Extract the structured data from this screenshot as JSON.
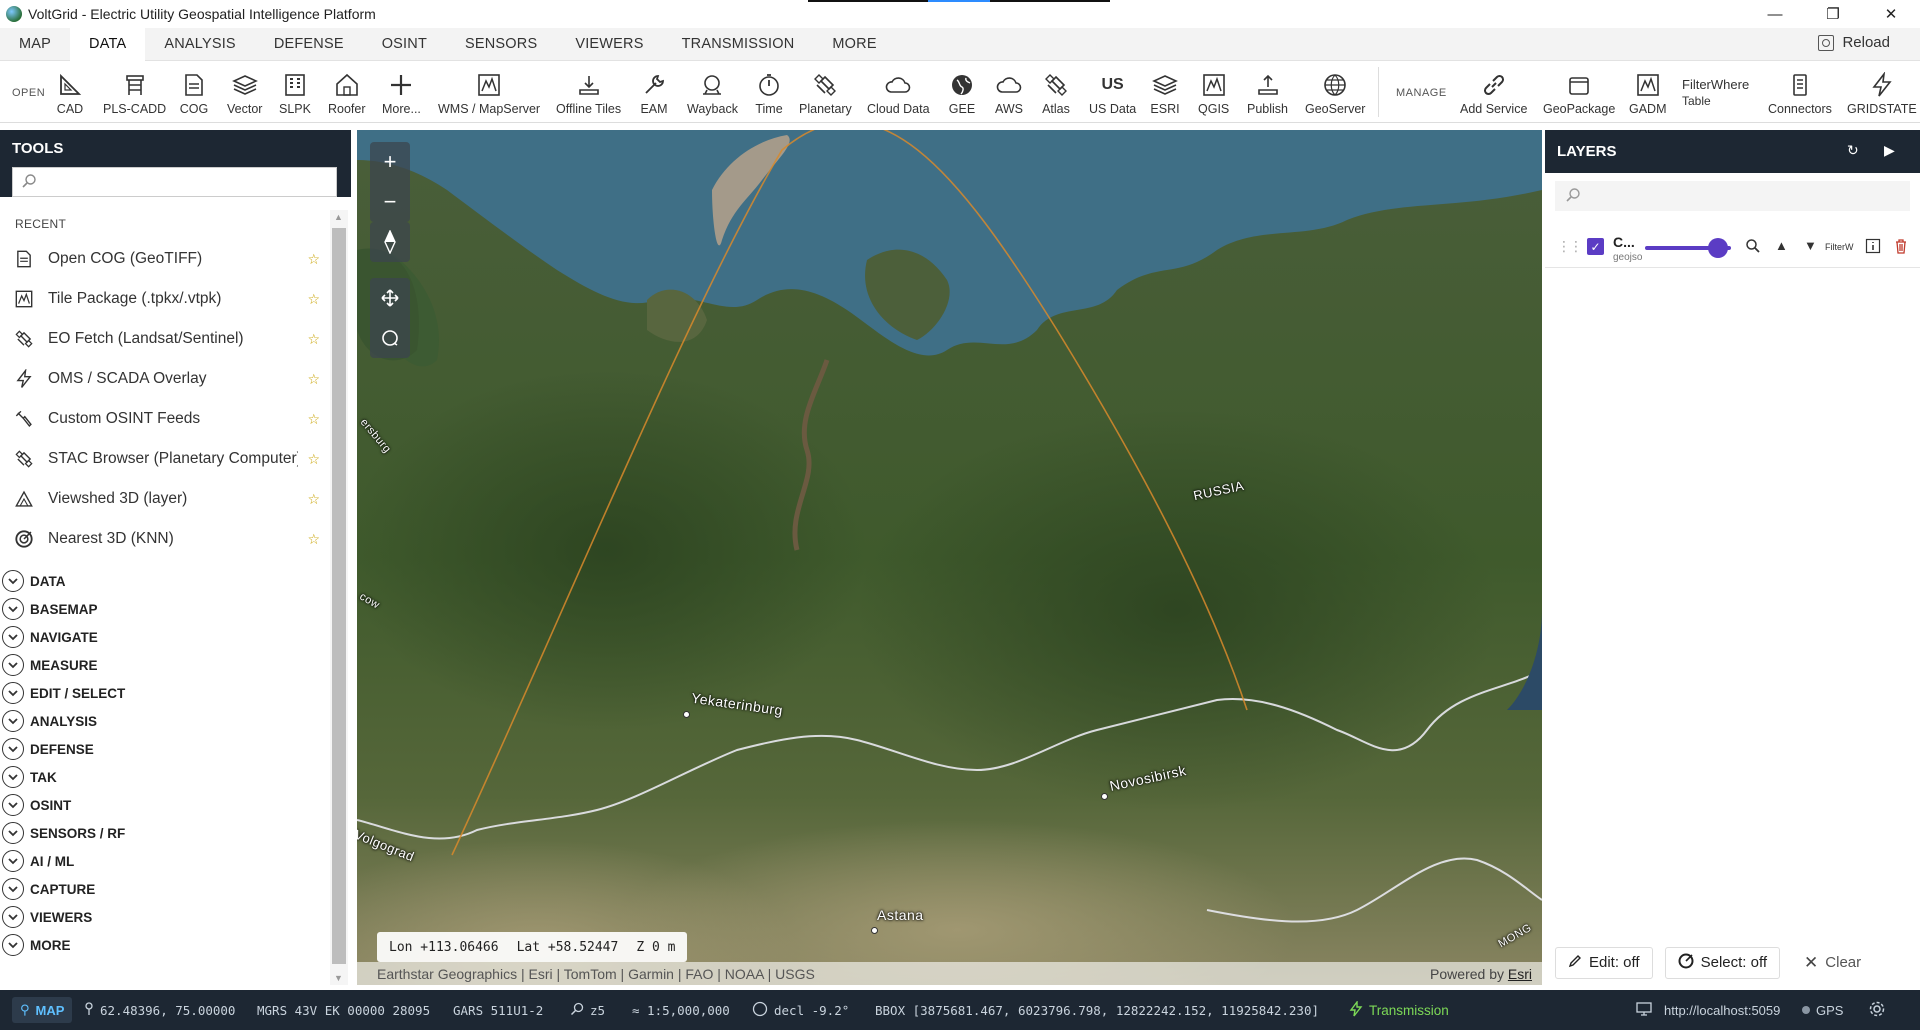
{
  "window": {
    "title": "VoltGrid - Electric Utility Geospatial Intelligence Platform",
    "minimize": "—",
    "restore": "❐",
    "close": "✕"
  },
  "menu": {
    "tabs": [
      {
        "label": "MAP"
      },
      {
        "label": "DATA"
      },
      {
        "label": "ANALYSIS"
      },
      {
        "label": "DEFENSE"
      },
      {
        "label": "OSINT"
      },
      {
        "label": "SENSORS"
      },
      {
        "label": "VIEWERS"
      },
      {
        "label": "TRANSMISSION"
      },
      {
        "label": "MORE"
      }
    ],
    "active": "DATA",
    "reload_label": "Reload"
  },
  "ribbon": {
    "open_label": "OPEN",
    "manage_label": "MANAGE",
    "buttons": [
      {
        "label": "CAD",
        "icon": "cad-icon"
      },
      {
        "label": "PLS-CADD",
        "icon": "tower-icon"
      },
      {
        "label": "COG",
        "icon": "cog-file-icon"
      },
      {
        "label": "Vector",
        "icon": "stack-icon"
      },
      {
        "label": "SLPK",
        "icon": "building-icon"
      },
      {
        "label": "Roofer",
        "icon": "house-icon"
      },
      {
        "label": "More...",
        "icon": "plus-icon"
      },
      {
        "label": "WMS / MapServer",
        "icon": "map-frame-icon"
      },
      {
        "label": "Offline Tiles",
        "icon": "offline-icon"
      },
      {
        "label": "EAM",
        "icon": "wrench-icon"
      },
      {
        "label": "Wayback",
        "icon": "wayback-icon"
      },
      {
        "label": "Time",
        "icon": "stopwatch-icon"
      },
      {
        "label": "Planetary",
        "icon": "satellite-icon"
      },
      {
        "label": "Cloud Data",
        "icon": "cloud-icon"
      },
      {
        "label": "GEE",
        "icon": "globe-icon"
      },
      {
        "label": "AWS",
        "icon": "aws-cloud-icon"
      },
      {
        "label": "Atlas",
        "icon": "atlas-icon"
      },
      {
        "label": "US Data",
        "icon": "us-icon"
      },
      {
        "label": "ESRI",
        "icon": "esri-icon"
      },
      {
        "label": "QGIS",
        "icon": "qgis-icon"
      },
      {
        "label": "Publish",
        "icon": "publish-icon"
      },
      {
        "label": "GeoServer",
        "icon": "geoserver-icon"
      },
      {
        "label": "Add Service",
        "icon": "link-icon"
      },
      {
        "label": "GeoPackage",
        "icon": "geopackage-icon"
      },
      {
        "label": "GADM",
        "icon": "gadm-icon"
      },
      {
        "label": "Connectors",
        "icon": "connectors-icon"
      },
      {
        "label": "GRIDSTATE",
        "icon": "bolt-icon"
      }
    ],
    "filterwhere_line1": "FilterWhere",
    "filterwhere_line2": "Table",
    "us_glyph": "US"
  },
  "tools": {
    "title": "TOOLS",
    "search_placeholder": "",
    "recent_label": "RECENT",
    "recent": [
      {
        "label": "Open COG (GeoTIFF)",
        "icon": "cog-file-icon"
      },
      {
        "label": "Tile Package (.tpkx/.vtpk)",
        "icon": "map-frame-icon"
      },
      {
        "label": "EO Fetch (Landsat/Sentinel)",
        "icon": "satellite-icon"
      },
      {
        "label": "OMS / SCADA Overlay",
        "icon": "bolt-icon"
      },
      {
        "label": "Custom OSINT Feeds",
        "icon": "feed-icon"
      },
      {
        "label": "STAC Browser (Planetary Computer)",
        "icon": "satellite-icon"
      },
      {
        "label": "Viewshed 3D (layer)",
        "icon": "viewshed-icon"
      },
      {
        "label": "Nearest 3D (KNN)",
        "icon": "target-icon"
      }
    ],
    "star": "☆",
    "categories": [
      {
        "label": "DATA"
      },
      {
        "label": "BASEMAP"
      },
      {
        "label": "NAVIGATE"
      },
      {
        "label": "MEASURE"
      },
      {
        "label": "EDIT / SELECT"
      },
      {
        "label": "ANALYSIS"
      },
      {
        "label": "DEFENSE"
      },
      {
        "label": "TAK"
      },
      {
        "label": "OSINT"
      },
      {
        "label": "SENSORS / RF"
      },
      {
        "label": "AI / ML"
      },
      {
        "label": "CAPTURE"
      },
      {
        "label": "VIEWERS"
      },
      {
        "label": "MORE"
      }
    ]
  },
  "map": {
    "places": [
      {
        "name": "RUSSIA"
      },
      {
        "name": "Yekaterinburg"
      },
      {
        "name": "Novosibirsk"
      },
      {
        "name": "Astana"
      },
      {
        "name": "Volgograd"
      },
      {
        "name": "ersburg"
      },
      {
        "name": "cow"
      },
      {
        "name": "MONG"
      }
    ],
    "coords": {
      "lon": "Lon +113.06466",
      "lat": "Lat +58.52447",
      "z": "Z 0 m"
    },
    "attribution": "Earthstar Geographics | Esri | TomTom | Garmin | FAO | NOAA | USGS",
    "powered_by": "Powered by",
    "powered_link": "Esri",
    "zoom_in": "+",
    "zoom_out": "−"
  },
  "layers": {
    "title": "LAYERS",
    "search_placeholder": "",
    "items": [
      {
        "name": "C...",
        "type": "geojso",
        "filter": "FilterW",
        "opacity": 0.85
      }
    ],
    "edit_label": "Edit: off",
    "select_label": "Select: off",
    "clear_label": "Clear"
  },
  "status": {
    "mode": "MAP",
    "latlon": "62.48396, 75.00000",
    "mgrs": "MGRS 43V EK 00000 28095",
    "gars": "GARS 511U1-2",
    "zoom": "z5",
    "scale": "≈ 1:5,000,000",
    "decl": "decl -9.2°",
    "bbox": "BBOX [3875681.467, 6023796.798, 12822242.152, 11925842.230]",
    "transmission": "Transmission",
    "server": "http://localhost:5059",
    "gps": "GPS"
  },
  "colors": {
    "dark_header": "#1d2733",
    "accent_purple": "#5b3cc4",
    "geodesic_line": "#d88a2c",
    "status_green": "#7dd957"
  }
}
